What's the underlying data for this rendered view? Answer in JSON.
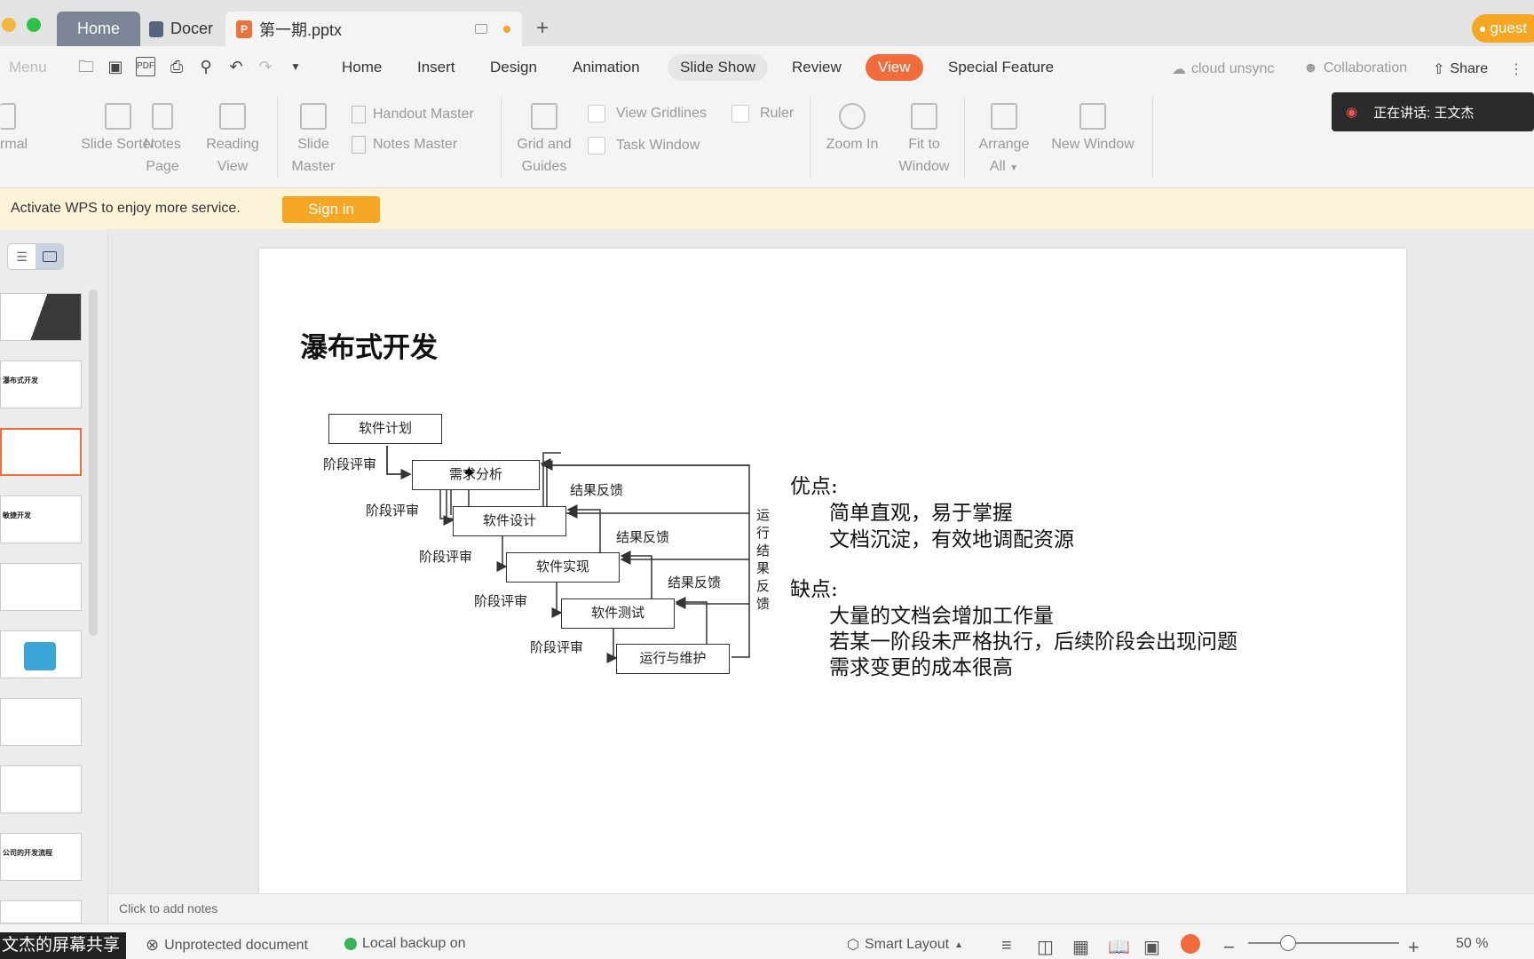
{
  "tabs": {
    "home": "Home",
    "docer": "Docer",
    "file": "第一期.pptx"
  },
  "guest": "guest",
  "menu": {
    "label": "Menu",
    "items": [
      "Home",
      "Insert",
      "Design",
      "Animation",
      "Slide Show",
      "Review",
      "View",
      "Special Feature"
    ],
    "cloud": "cloud unsync",
    "collab": "Collaboration",
    "share": "Share"
  },
  "ribbon": {
    "normal": "rmal",
    "slide_sorter": "Slide Sorter",
    "notes_page_1": "Notes",
    "notes_page_2": "Page",
    "reading_1": "Reading",
    "reading_2": "View",
    "slide_master_1": "Slide",
    "slide_master_2": "Master",
    "handout_master": "Handout Master",
    "notes_master": "Notes Master",
    "grid_1": "Grid and",
    "grid_2": "Guides",
    "view_gridlines": "View Gridlines",
    "ruler": "Ruler",
    "task_window": "Task Window",
    "zoom_in": "Zoom In",
    "fit_1": "Fit to",
    "fit_2": "Window",
    "arrange_1": "Arrange",
    "arrange_2": "All",
    "new_window": "New Window"
  },
  "speaker": "正在讲话: 王文杰",
  "banner": {
    "text": "Activate WPS to enjoy more service.",
    "signin": "Sign in"
  },
  "thumbs": [
    "瀑布式开发",
    "敏捷开发",
    "公司的开发流程"
  ],
  "slide": {
    "title": "瀑布式开发",
    "diagram": {
      "boxes": [
        "软件计划",
        "需求分析",
        "软件设计",
        "软件实现",
        "软件测试",
        "运行与维护"
      ],
      "review": "阶段评审",
      "feedback": "结果反馈",
      "run_feedback": "运行结果反馈"
    },
    "pros_title": "优点:",
    "pros": [
      "简单直观，易于掌握",
      "文档沉淀，有效地调配资源"
    ],
    "cons_title": "缺点:",
    "cons": [
      "大量的文档会增加工作量",
      "若某一阶段未严格执行，后续阶段会出现问题",
      "需求变更的成本很高"
    ]
  },
  "notes": "Click to add notes",
  "status": {
    "screen_share": "文杰的屏幕共享",
    "unprotected": "Unprotected document",
    "backup": "Local backup on",
    "smart_layout": "Smart Layout",
    "zoom": "50 %"
  },
  "colors": {
    "accent": "#f26b3a",
    "warning": "#f5a623",
    "tab_home": "#7c8596"
  }
}
